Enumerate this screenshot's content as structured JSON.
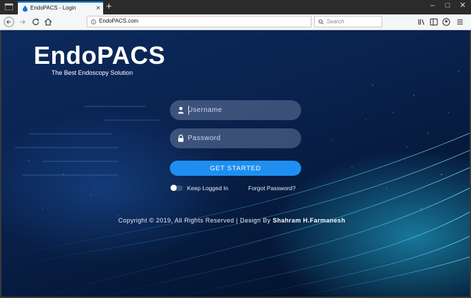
{
  "browser": {
    "tab_title": "EndoPACS - Login",
    "tab_close": "×",
    "new_tab": "+",
    "url": "EndoPACS.com",
    "search_placeholder": "Search",
    "window_controls": {
      "minimize": "–",
      "maximize": "□",
      "close": "✕"
    }
  },
  "page": {
    "brand": "EndoPACS",
    "tagline": "The Best Endoscopy Solution",
    "username_placeholder": "Username",
    "password_placeholder": "Password",
    "submit_label": "GET STARTED",
    "keep_logged_in": "Keep Logged In",
    "forgot_password": "Forgot Password?",
    "footer_text": "Copyright © 2019, All Rights Reserved | Design By ",
    "footer_author": "Shahram H.Farmanesh"
  },
  "colors": {
    "accent": "#1e8ff0",
    "tab_highlight": "#0a84ff"
  }
}
